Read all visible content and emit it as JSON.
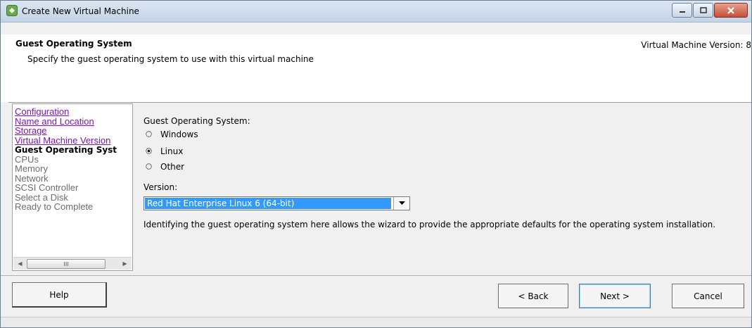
{
  "window": {
    "title": "Create New Virtual Machine",
    "controls": [
      "minimize-icon",
      "maximize-icon",
      "close-icon"
    ]
  },
  "header": {
    "title": "Guest Operating System",
    "subtitle": "Specify the guest operating system to use with this virtual machine",
    "version_label": "Virtual Machine Version: 8"
  },
  "nav": {
    "items": [
      {
        "label": "Configuration",
        "state": "visited"
      },
      {
        "label": "Name and Location",
        "state": "visited"
      },
      {
        "label": "Storage",
        "state": "visited"
      },
      {
        "label": "Virtual Machine Version",
        "state": "visited"
      },
      {
        "label": "Guest Operating Syst",
        "state": "current"
      },
      {
        "label": "CPUs",
        "state": "future"
      },
      {
        "label": "Memory",
        "state": "future"
      },
      {
        "label": "Network",
        "state": "future"
      },
      {
        "label": "SCSI Controller",
        "state": "future"
      },
      {
        "label": "Select a Disk",
        "state": "future"
      },
      {
        "label": "Ready to Complete",
        "state": "future"
      }
    ],
    "scrollbar_thumb_glyph": "III"
  },
  "form": {
    "os_label": "Guest Operating System:",
    "os_options": [
      {
        "label": "Windows",
        "selected": false
      },
      {
        "label": "Linux",
        "selected": true
      },
      {
        "label": "Other",
        "selected": false
      }
    ],
    "version_label": "Version:",
    "version_value": "Red Hat Enterprise Linux 6 (64-bit)",
    "description": "Identifying the guest operating system here allows the wizard to provide the appropriate defaults for the operating system installation."
  },
  "buttons": {
    "help": "Help",
    "back": "< Back",
    "next": "Next >",
    "cancel": "Cancel"
  },
  "colors": {
    "link": "#7b16b3",
    "selection": "#3399ff",
    "close_button": "#c7503a"
  }
}
